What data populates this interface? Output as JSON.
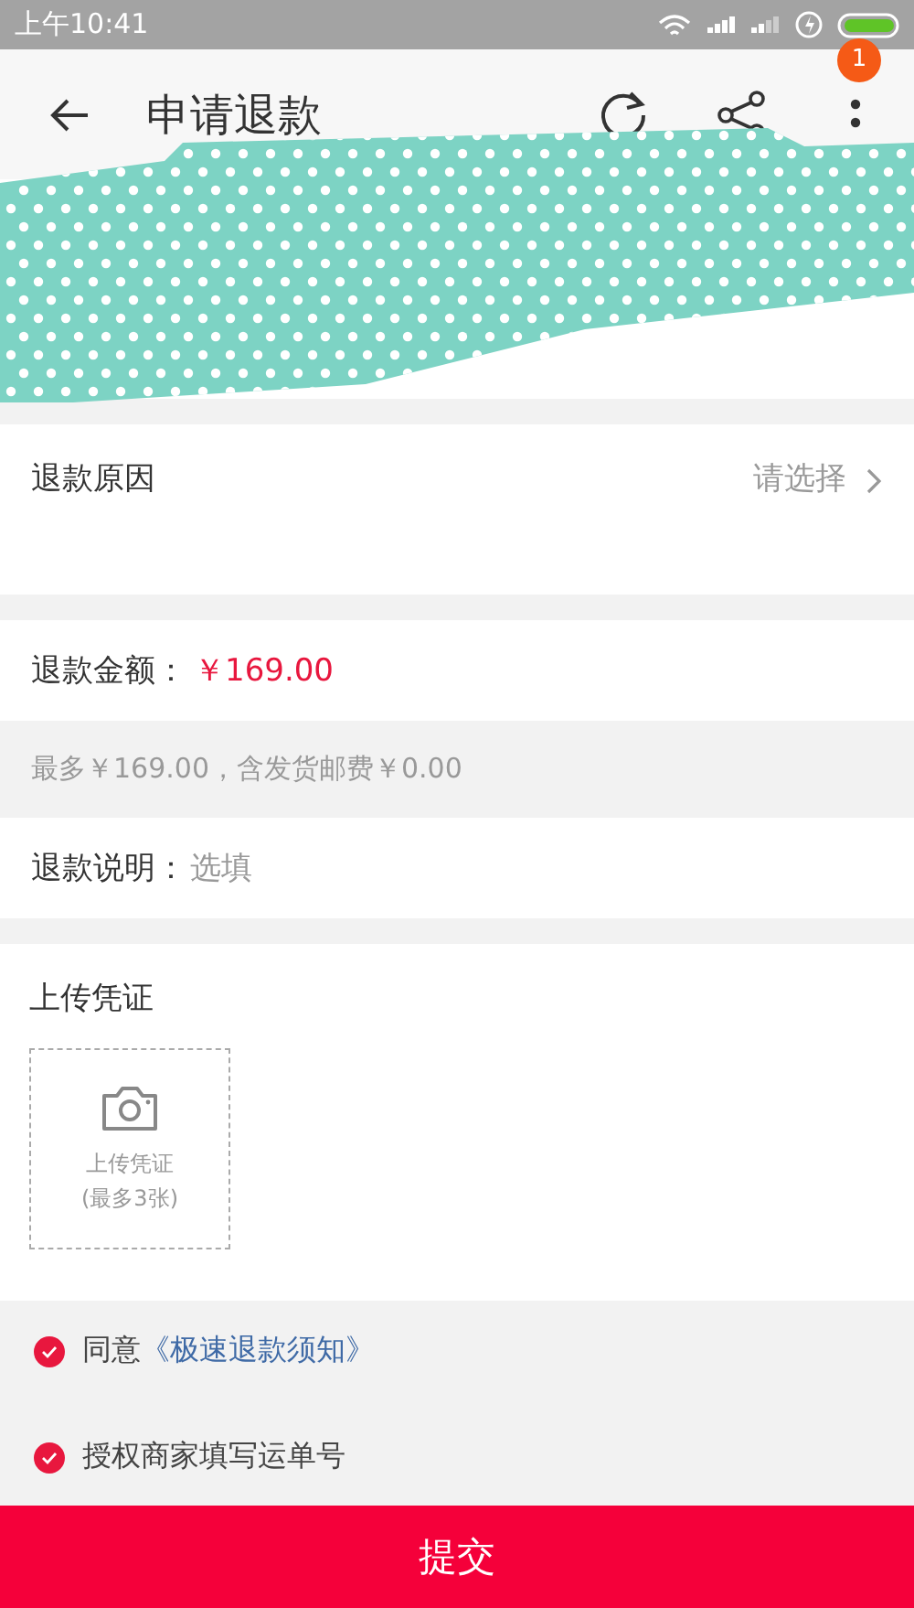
{
  "status_bar": {
    "time": "上午10:41"
  },
  "header": {
    "title": "申请退款",
    "badge": "1"
  },
  "reason": {
    "label": "退款原因",
    "placeholder": "请选择"
  },
  "amount": {
    "label": "退款金额：",
    "value": "￥169.00"
  },
  "amount_hint": "最多￥169.00，含发货邮费￥0.00",
  "description": {
    "label": "退款说明：",
    "placeholder": "选填"
  },
  "upload": {
    "title": "上传凭证",
    "button_label": "上传凭证",
    "button_note": "(最多3张)"
  },
  "agreements": [
    {
      "text": "同意",
      "link": "《极速退款须知》",
      "checked": true
    },
    {
      "text": "授权商家填写运单号",
      "checked": true
    }
  ],
  "submit": "提交"
}
